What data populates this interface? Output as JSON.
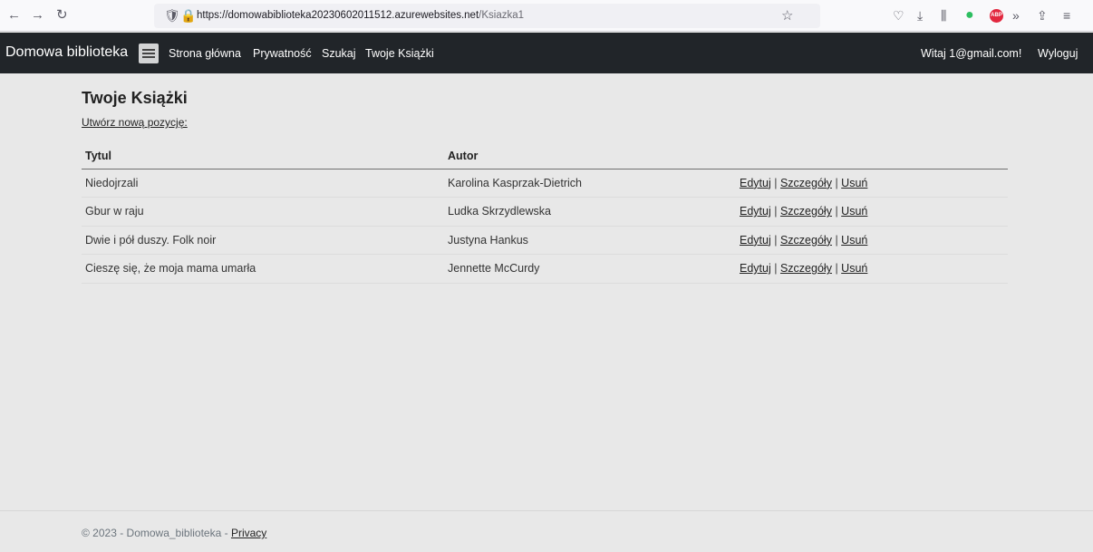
{
  "browser": {
    "back_icon": "back-arrow-icon",
    "forward_icon": "forward-arrow-icon",
    "reload_icon": "reload-icon",
    "url_host": "https://domowabiblioteka20230602011512.azurewebsites.net",
    "url_path": "/Ksiazka1"
  },
  "navbar": {
    "brand": "Domowa biblioteka",
    "links": [
      "Strona główna",
      "Prywatność",
      "Szukaj",
      "Twoje Książki"
    ],
    "greeting": "Witaj 1@gmail.com!",
    "logout": "Wyloguj"
  },
  "main": {
    "title": "Twoje Książki",
    "create_link": "Utwórz nową pozycję:",
    "table": {
      "headers": [
        "Tytul",
        "Autor",
        ""
      ],
      "rows": [
        {
          "title": "Niedojrzali",
          "author": "Karolina Kasprzak-Dietrich"
        },
        {
          "title": "Gbur w raju",
          "author": "Ludka Skrzydlewska"
        },
        {
          "title": "Dwie i pół duszy. Folk noir",
          "author": "Justyna Hankus"
        },
        {
          "title": "Cieszę się, że moja mama umarła",
          "author": "Jennette McCurdy"
        }
      ],
      "actions": {
        "edit": "Edytuj",
        "details": "Szczegóły",
        "delete": "Usuń",
        "separator": "|"
      }
    }
  },
  "footer": {
    "text": "© 2023 - Domowa_biblioteka - ",
    "privacy": "Privacy"
  },
  "colors": {
    "navbar_bg": "#212529",
    "page_bg": "#e8e8e8"
  }
}
